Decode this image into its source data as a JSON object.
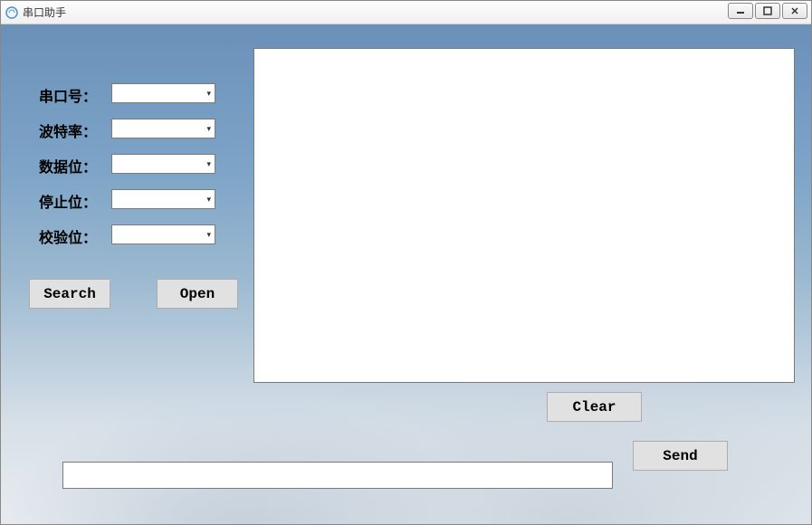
{
  "window": {
    "title": "串口助手"
  },
  "labels": {
    "port": "串口号：",
    "baud": "波特率：",
    "databits": "数据位：",
    "stopbits": "停止位：",
    "parity": "校验位："
  },
  "combos": {
    "port": "",
    "baud": "",
    "databits": "",
    "stopbits": "",
    "parity": ""
  },
  "buttons": {
    "search": "Search",
    "open": "Open",
    "clear": "Clear",
    "send": "Send"
  },
  "receive_text": "",
  "send_text": ""
}
